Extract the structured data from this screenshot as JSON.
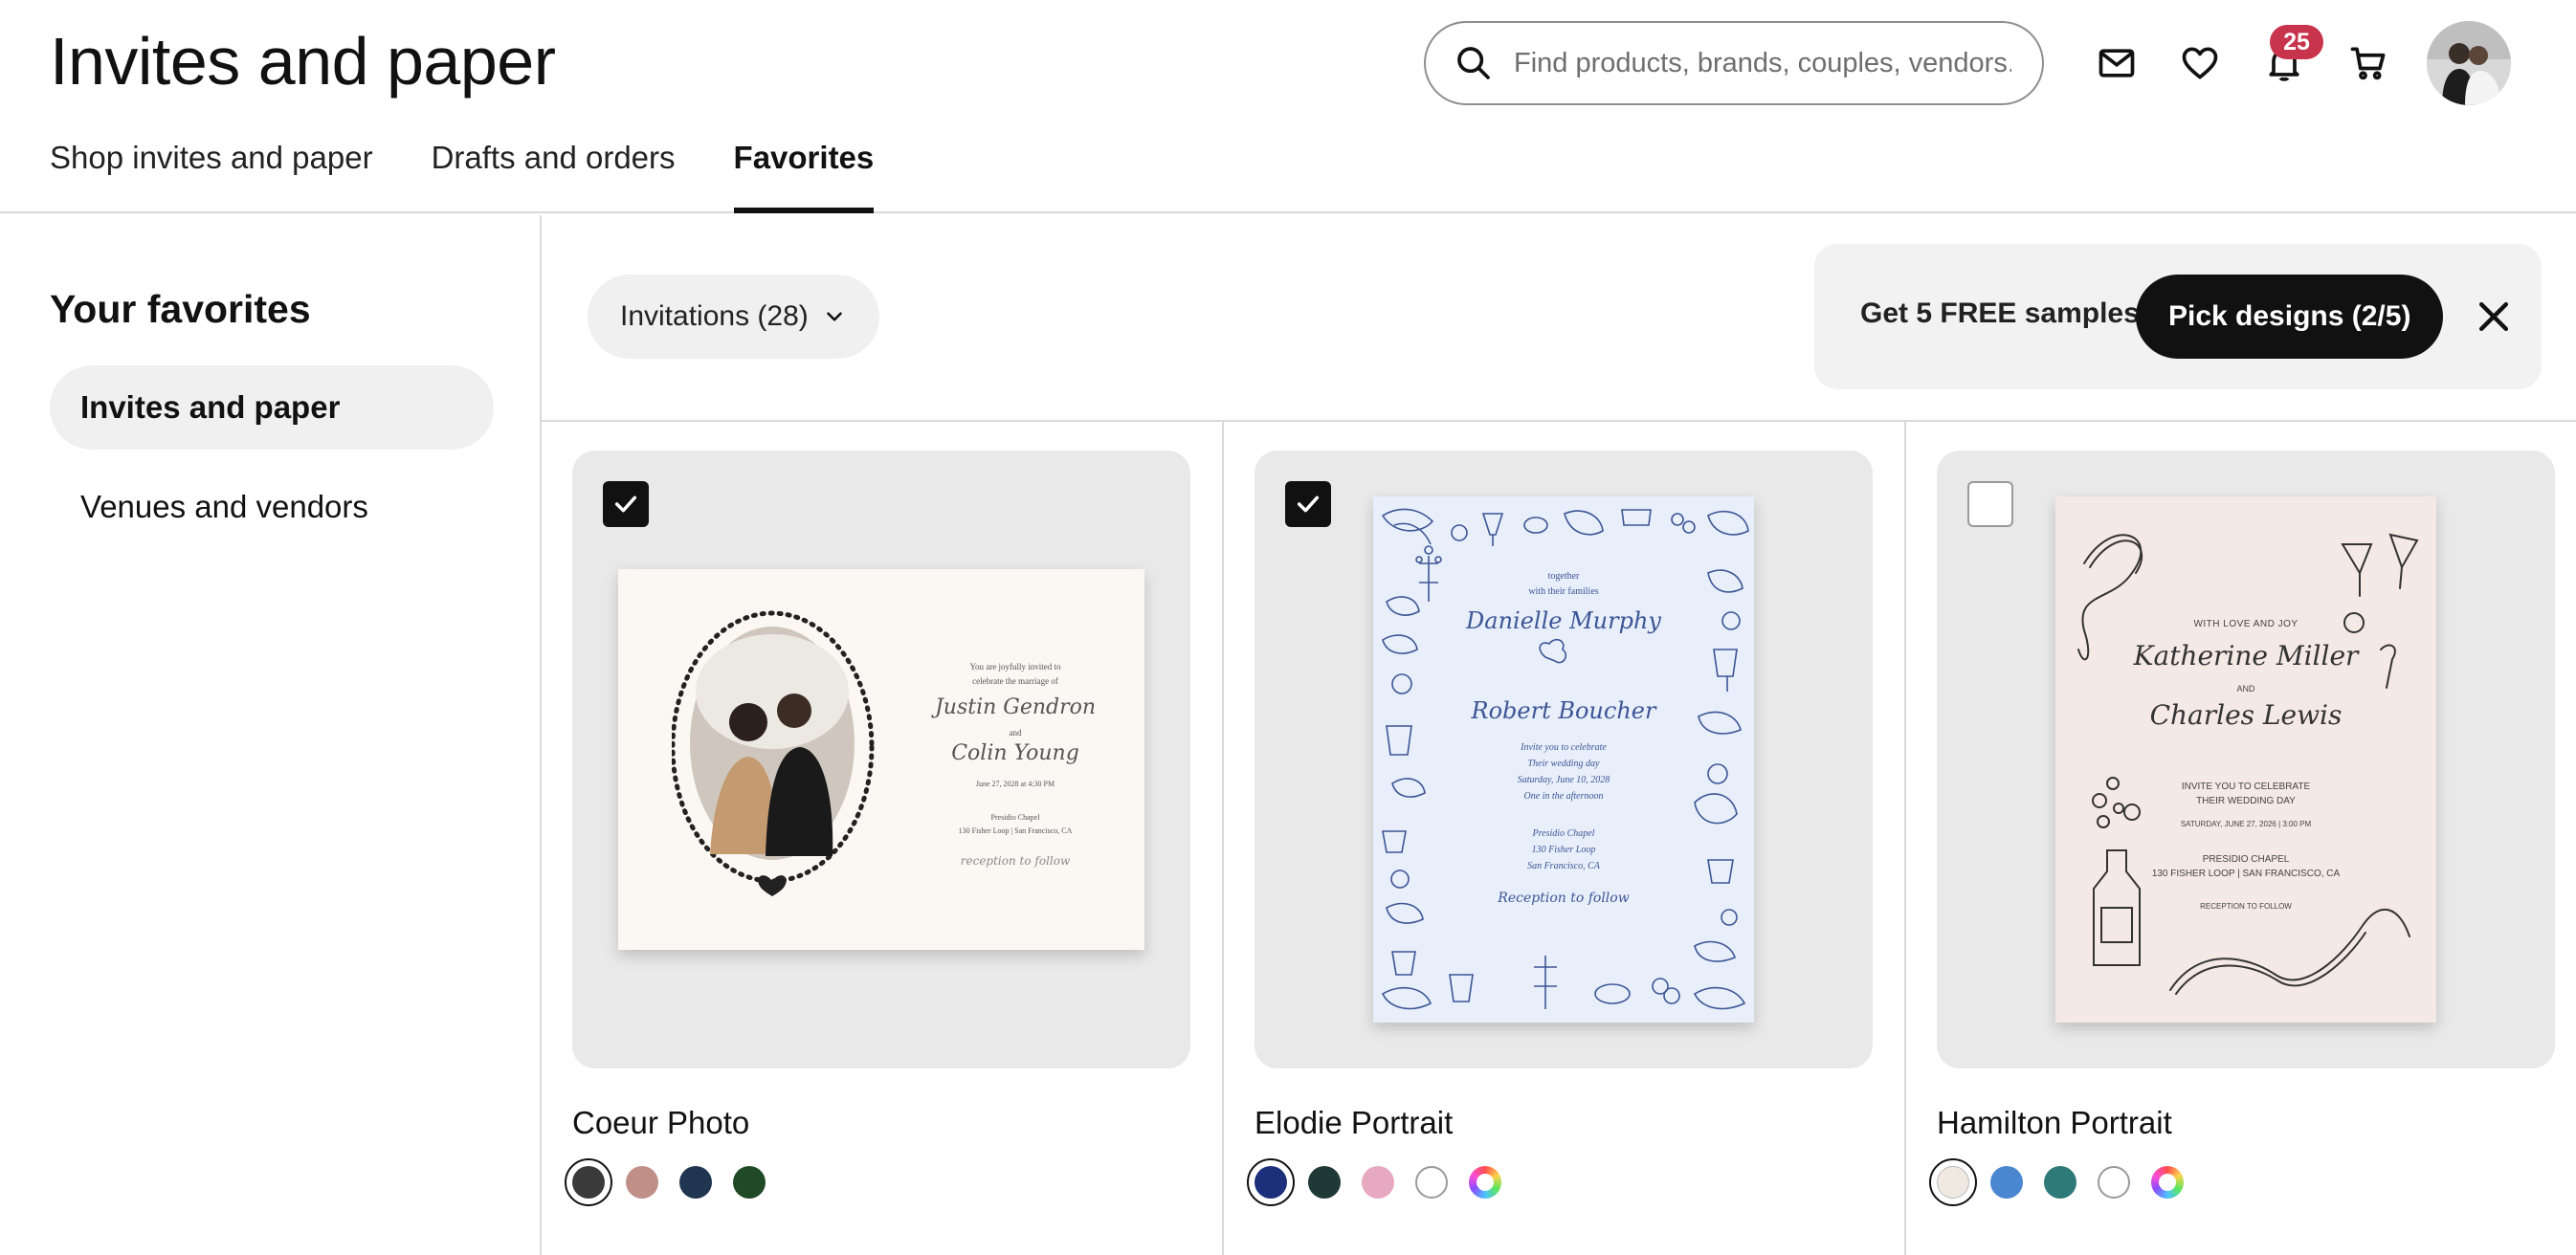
{
  "header": {
    "title": "Invites and paper",
    "tabs": [
      {
        "label": "Shop invites and paper"
      },
      {
        "label": "Drafts and orders"
      },
      {
        "label": "Favorites"
      }
    ],
    "search_placeholder": "Find products, brands, couples, vendors...",
    "notification_count": "25",
    "icons": [
      "search-icon",
      "mail-icon",
      "heart-icon",
      "bell-icon",
      "cart-icon"
    ]
  },
  "sidebar": {
    "heading": "Your favorites",
    "items": [
      {
        "label": "Invites and paper",
        "active": true
      },
      {
        "label": "Venues and vendors",
        "active": false
      }
    ]
  },
  "toolbar": {
    "filter_label": "Invitations (28)",
    "samples_text": "Get 5 FREE samples",
    "pick_button": "Pick designs (2/5)"
  },
  "products": [
    {
      "name": "Coeur Photo",
      "checked": true,
      "swatches": [
        "#3a3a3a",
        "#c08f88",
        "#1f3550",
        "#1f4a25"
      ],
      "invite": {
        "l1": "You are joyfully invited to",
        "l2": "celebrate the marriage of",
        "n1": "Justin Gendron",
        "and": "and",
        "n2": "Colin Young",
        "date": "June 27, 2028 at 4:30 PM",
        "v1": "Presidio Chapel",
        "v2": "130 Fisher Loop | San Francisco, CA",
        "r": "reception to follow"
      }
    },
    {
      "name": "Elodie Portrait",
      "checked": true,
      "swatches": [
        "#1c2f7a",
        "#1f3a36",
        "#e6a9bf",
        "#ffffff",
        "rainbow"
      ],
      "invite": {
        "l1": "together",
        "l2": "with their families",
        "n1": "Danielle Murphy",
        "n2": "Robert Boucher",
        "t1": "Invite you to celebrate",
        "t2": "Their wedding day",
        "t3": "Saturday, June 10, 2028",
        "t4": "One in the afternoon",
        "v1": "Presidio Chapel",
        "v2": "130 Fisher Loop",
        "v3": "San Francisco, CA",
        "r": "Reception to follow"
      }
    },
    {
      "name": "Hamilton Portrait",
      "checked": false,
      "swatches": [
        "#efe9e2",
        "#4a87d0",
        "#2d7a78",
        "#ffffff",
        "rainbow"
      ],
      "invite": {
        "l1": "WITH LOVE AND JOY",
        "n1": "Katherine Miller",
        "and": "AND",
        "n2": "Charles Lewis",
        "t1": "INVITE YOU TO CELEBRATE",
        "t2": "THEIR WEDDING DAY",
        "t3": "SATURDAY, JUNE 27, 2026 | 3:00 PM",
        "v1": "PRESIDIO CHAPEL",
        "v2": "130 FISHER LOOP | SAN FRANCISCO, CA",
        "r": "RECEPTION TO FOLLOW"
      }
    }
  ]
}
